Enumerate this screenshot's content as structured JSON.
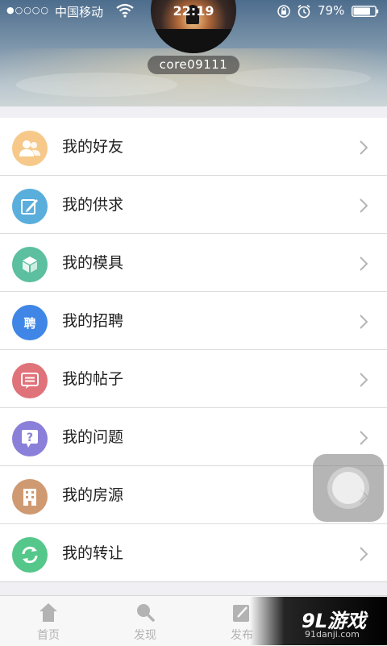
{
  "status_bar": {
    "signal": "●○○○○",
    "carrier": "中国移动",
    "time": "22:19",
    "battery_percent": "79%",
    "battery_level": 0.79
  },
  "profile": {
    "username": "core09111"
  },
  "menu": {
    "items": [
      {
        "label": "我的好友",
        "icon": "friends-icon",
        "color": "#f6c98a"
      },
      {
        "label": "我的供求",
        "icon": "edit-icon",
        "color": "#5aaedc"
      },
      {
        "label": "我的模具",
        "icon": "cube-icon",
        "color": "#5cbf9f"
      },
      {
        "label": "我的招聘",
        "icon": "recruit-icon",
        "icon_text": "聘",
        "color": "#3f86e6"
      },
      {
        "label": "我的帖子",
        "icon": "post-icon",
        "color": "#e0727a"
      },
      {
        "label": "我的问题",
        "icon": "question-icon",
        "color": "#8a7fd9"
      },
      {
        "label": "我的房源",
        "icon": "building-icon",
        "color": "#cf9a72"
      },
      {
        "label": "我的转让",
        "icon": "transfer-icon",
        "color": "#56c78a"
      }
    ]
  },
  "tabbar": {
    "tabs": [
      {
        "label": "首页",
        "icon": "home-icon"
      },
      {
        "label": "发现",
        "icon": "search-icon"
      },
      {
        "label": "发布",
        "icon": "publish-icon"
      }
    ]
  },
  "watermark": {
    "logo": "9L游戏",
    "site": "91danji.com"
  }
}
